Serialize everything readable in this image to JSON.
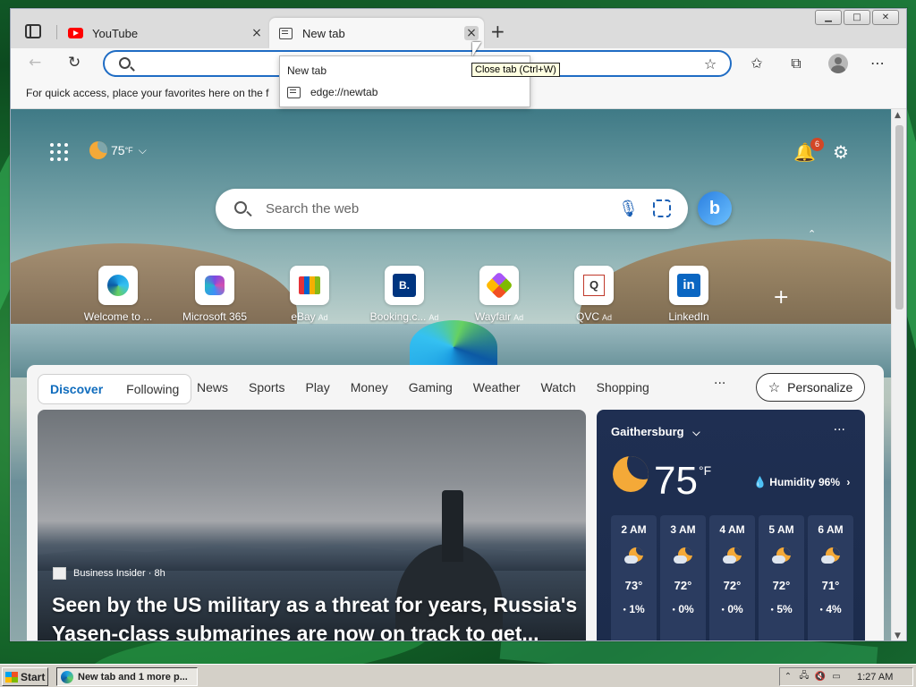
{
  "browser": {
    "tabs": [
      {
        "title": "YouTube",
        "close_icon": "×"
      },
      {
        "title": "New tab",
        "close_icon": "×"
      }
    ],
    "new_tab_icon": "+",
    "window_controls": [
      "▁",
      "□",
      "✕"
    ],
    "nav": {
      "back_icon": "←",
      "refresh_icon": "↻"
    },
    "address_bar": {
      "value": "",
      "placeholder": ""
    },
    "toolbar_icons": {
      "add_favorite": "☆",
      "favorites": "✩",
      "collections": "⧉",
      "more": "⋯"
    },
    "favorites_bar_text": "For quick access, place your favorites here on the f",
    "tab_preview": {
      "title": "New tab",
      "url": "edge://newtab"
    },
    "tooltip": "Close tab (Ctrl+W)"
  },
  "newtab": {
    "weather": {
      "temp": "75",
      "unit": "°F",
      "chevron": "⌵"
    },
    "notifications": {
      "icon": "🔔",
      "count": "6"
    },
    "settings_icon": "⚙",
    "search": {
      "placeholder": "Search the web",
      "mic_icon": "🎙",
      "bing_label": "b"
    },
    "collapse_icon": "⌃",
    "quick_links": [
      {
        "label": "Welcome to ...",
        "ad": "",
        "icon": "edge-icon"
      },
      {
        "label": "Microsoft 365",
        "ad": "",
        "icon": "m365-icon"
      },
      {
        "label": "eBay",
        "ad": "Ad",
        "icon": "ebay-icon"
      },
      {
        "label": "Booking.c...",
        "ad": "Ad",
        "icon": "booking-icon",
        "glyph": "B."
      },
      {
        "label": "Wayfair",
        "ad": "Ad",
        "icon": "wayfair-icon"
      },
      {
        "label": "QVC",
        "ad": "Ad",
        "icon": "qvc-icon",
        "glyph": "Q"
      },
      {
        "label": "LinkedIn",
        "ad": "",
        "icon": "linkedin-icon",
        "glyph": "in"
      }
    ],
    "add_link_icon": "+",
    "feed": {
      "pivots": [
        "Discover",
        "Following"
      ],
      "nav": [
        "News",
        "Sports",
        "Play",
        "Money",
        "Gaming",
        "Weather",
        "Watch",
        "Shopping"
      ],
      "more": "···",
      "personalize": "Personalize",
      "hero": {
        "source": "Business Insider · 8h",
        "headline": "Seen by the US military as a threat for years, Russia's Yasen-class submarines are now on track to get..."
      },
      "weather_card": {
        "location": "Gaithersburg",
        "temp": "75",
        "unit": "°F",
        "humidity": "Humidity 96%",
        "hourly": [
          {
            "time": "2 AM",
            "temp": "73°",
            "precip": "1%"
          },
          {
            "time": "3 AM",
            "temp": "72°",
            "precip": "0%"
          },
          {
            "time": "4 AM",
            "temp": "72°",
            "precip": "0%"
          },
          {
            "time": "5 AM",
            "temp": "72°",
            "precip": "5%"
          },
          {
            "time": "6 AM",
            "temp": "71°",
            "precip": "4%"
          }
        ]
      }
    }
  },
  "taskbar": {
    "start": "Start",
    "task": "New tab and 1 more p...",
    "clock": "1:27 AM"
  },
  "colors": {
    "accent": "#1f6cc4",
    "discover": "#0f6cbd",
    "badge": "#d24726",
    "card": "#1f2f52"
  }
}
